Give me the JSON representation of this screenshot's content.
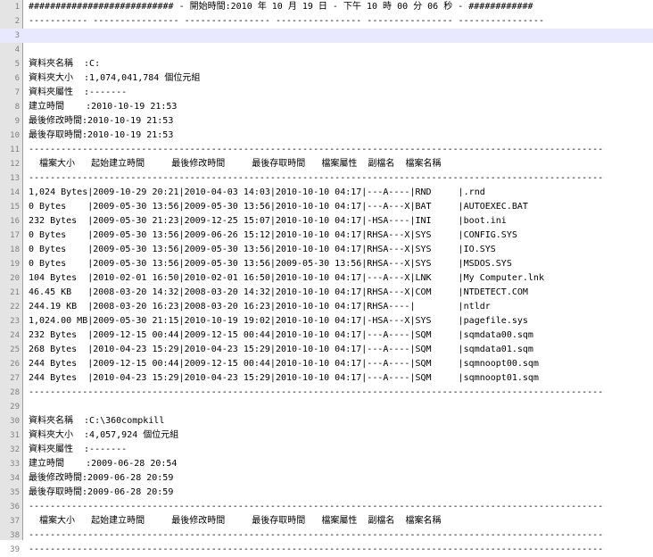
{
  "editor": {
    "current_line": 3,
    "lines": [
      "########################### - 開始時間:2010 年 10 月 19 日 - 下午 10 時 00 分 06 秒 - ############",
      "----------- ---------------- ---------------- ---------------- ---------------- ----------------",
      "",
      "",
      "資料夾名稱  :C:",
      "資料夾大小  :1,074,041,784 個位元組",
      "資料夾屬性  :-------",
      "建立時間    :2010-10-19 21:53",
      "最後修改時間:2010-10-19 21:53",
      "最後存取時間:2010-10-19 21:53",
      "-----------------------------------------------------------------------------------------------------------",
      "  檔案大小   起始建立時間     最後修改時間     最後存取時間   檔案屬性  副檔名  檔案名稱",
      "-----------------------------------------------------------------------------------------------------------",
      "1,024 Bytes|2009-10-29 20:21|2010-04-03 14:03|2010-10-10 04:17|---A----|RND     |.rnd",
      "0 Bytes    |2009-05-30 13:56|2009-05-30 13:56|2010-10-10 04:17|---A---X|BAT     |AUTOEXEC.BAT",
      "232 Bytes  |2009-05-30 21:23|2009-12-25 15:07|2010-10-10 04:17|-HSA----|INI     |boot.ini",
      "0 Bytes    |2009-05-30 13:56|2009-06-26 15:12|2010-10-10 04:17|RHSA---X|SYS     |CONFIG.SYS",
      "0 Bytes    |2009-05-30 13:56|2009-05-30 13:56|2010-10-10 04:17|RHSA---X|SYS     |IO.SYS",
      "0 Bytes    |2009-05-30 13:56|2009-05-30 13:56|2009-05-30 13:56|RHSA---X|SYS     |MSDOS.SYS",
      "104 Bytes  |2010-02-01 16:50|2010-02-01 16:50|2010-10-10 04:17|---A---X|LNK     |My Computer.lnk",
      "46.45 KB   |2008-03-20 14:32|2008-03-20 14:32|2010-10-10 04:17|RHSA---X|COM     |NTDETECT.COM",
      "244.19 KB  |2008-03-20 16:23|2008-03-20 16:23|2010-10-10 04:17|RHSA----|        |ntldr",
      "1,024.00 MB|2009-05-30 21:15|2010-10-19 19:02|2010-10-10 04:17|-HSA---X|SYS     |pagefile.sys",
      "232 Bytes  |2009-12-15 00:44|2009-12-15 00:44|2010-10-10 04:17|---A----|SQM     |sqmdata00.sqm",
      "268 Bytes  |2010-04-23 15:29|2010-04-23 15:29|2010-10-10 04:17|---A----|SQM     |sqmdata01.sqm",
      "244 Bytes  |2009-12-15 00:44|2009-12-15 00:44|2010-10-10 04:17|---A----|SQM     |sqmnoopt00.sqm",
      "244 Bytes  |2010-04-23 15:29|2010-04-23 15:29|2010-10-10 04:17|---A----|SQM     |sqmnoopt01.sqm",
      "-----------------------------------------------------------------------------------------------------------",
      "",
      "資料夾名稱  :C:\\360compkill",
      "資料夾大小  :4,057,924 個位元組",
      "資料夾屬性  :-------",
      "建立時間    :2009-06-28 20:54",
      "最後修改時間:2009-06-28 20:59",
      "最後存取時間:2009-06-28 20:59",
      "-----------------------------------------------------------------------------------------------------------",
      "  檔案大小   起始建立時間     最後修改時間     最後存取時間   檔案屬性  副檔名  檔案名稱",
      "-----------------------------------------------------------------------------------------------------------",
      "-----------------------------------------------------------------------------------------------------------"
    ]
  }
}
